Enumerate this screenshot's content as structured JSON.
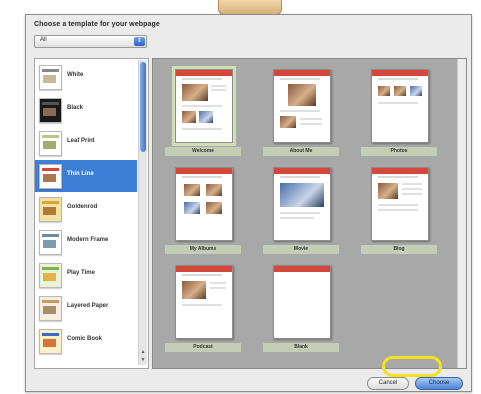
{
  "dialog": {
    "prompt": "Choose a template for your webpage",
    "category_select": {
      "value": "All"
    },
    "cancel_label": "Cancel",
    "choose_label": "Choose"
  },
  "themes": [
    {
      "label": "White",
      "selected": false
    },
    {
      "label": "Black",
      "selected": false
    },
    {
      "label": "Leaf Print",
      "selected": false
    },
    {
      "label": "Thin Line",
      "selected": true
    },
    {
      "label": "Goldenrod",
      "selected": false
    },
    {
      "label": "Modern Frame",
      "selected": false
    },
    {
      "label": "Play Time",
      "selected": false
    },
    {
      "label": "Layered Paper",
      "selected": false
    },
    {
      "label": "Comic Book",
      "selected": false
    }
  ],
  "templates": [
    {
      "label": "Welcome",
      "selected": true
    },
    {
      "label": "About Me",
      "selected": false
    },
    {
      "label": "Photos",
      "selected": false
    },
    {
      "label": "My Albums",
      "selected": false
    },
    {
      "label": "Movie",
      "selected": false
    },
    {
      "label": "Blog",
      "selected": false
    },
    {
      "label": "Podcast",
      "selected": false
    },
    {
      "label": "Blank",
      "selected": false
    }
  ],
  "colors": {
    "selection": "#3d7fd6",
    "template_header": "#d4483b",
    "highlight_ring": "#f2e21d"
  }
}
